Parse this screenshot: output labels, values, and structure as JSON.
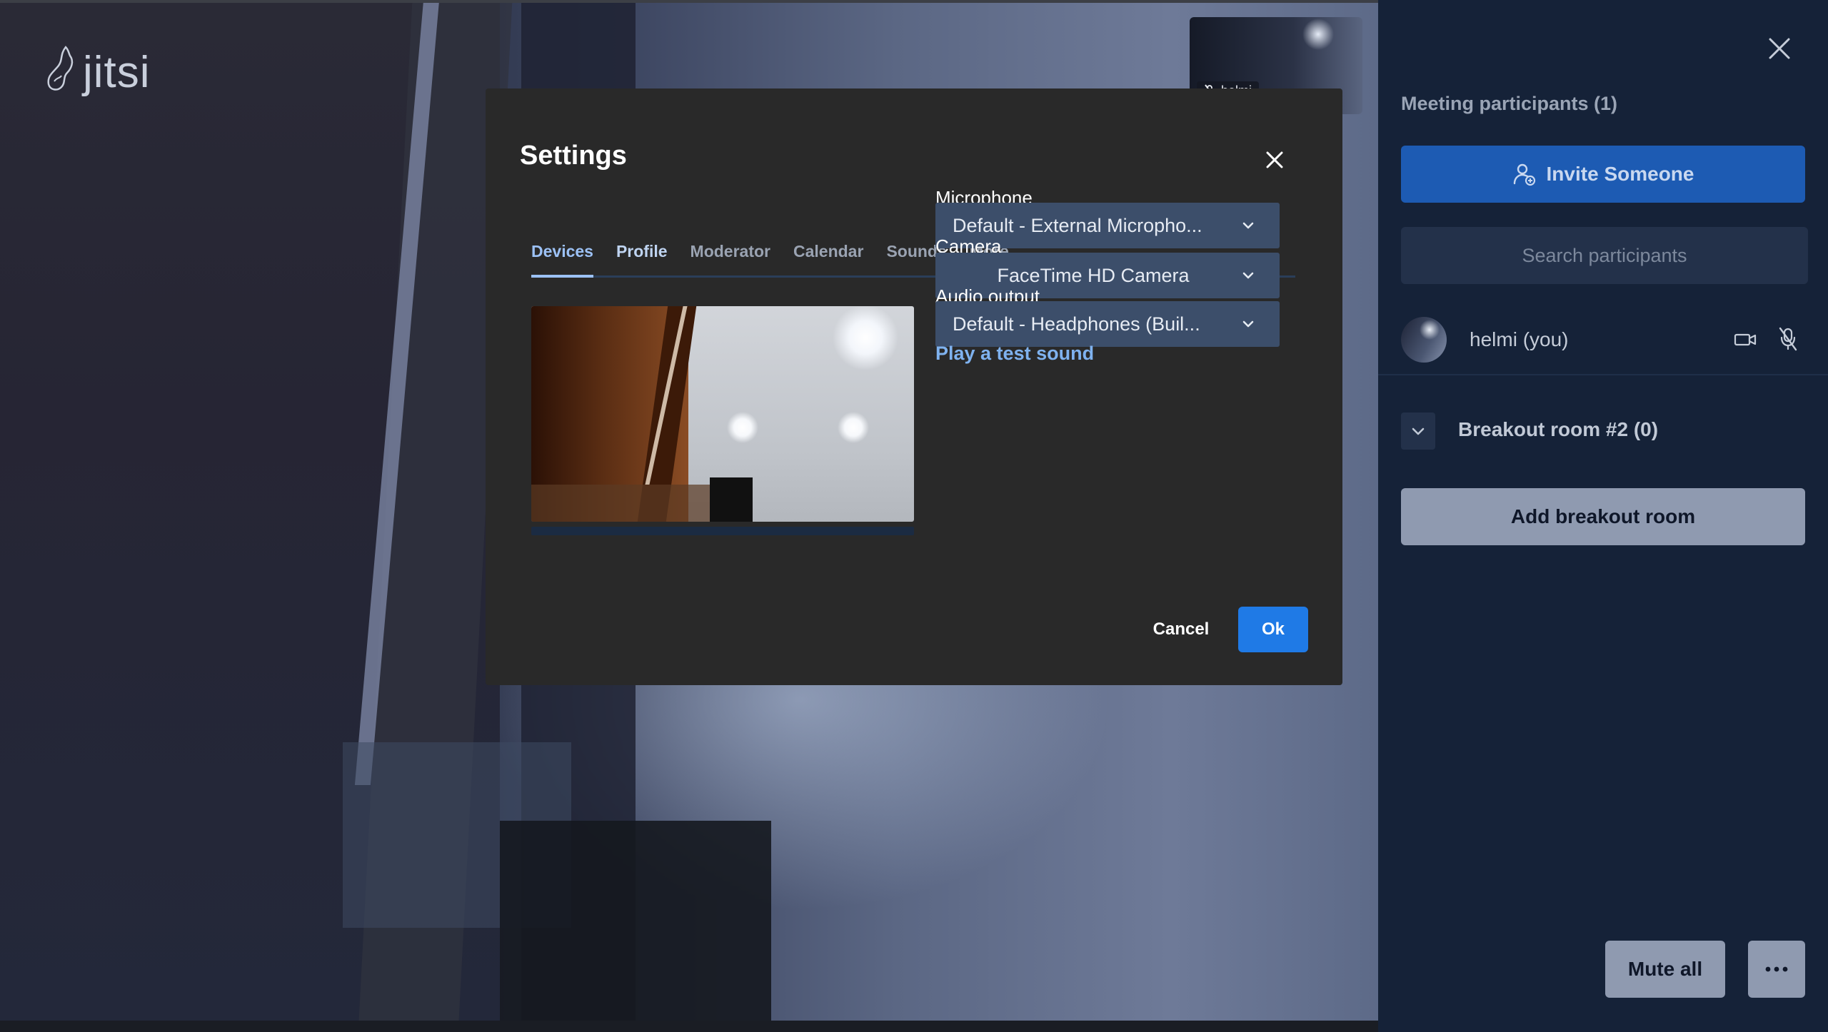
{
  "brand": {
    "logo_text": "jitsi"
  },
  "thumbnail": {
    "name": "helmi"
  },
  "settings": {
    "title": "Settings",
    "tabs": [
      {
        "label": "Devices",
        "active": true
      },
      {
        "label": "Profile",
        "active": false
      },
      {
        "label": "Moderator",
        "active": false
      },
      {
        "label": "Calendar",
        "active": false
      },
      {
        "label": "Sounds",
        "active": false
      },
      {
        "label": "More",
        "active": false
      }
    ],
    "microphone": {
      "label": "Microphone",
      "value": "Default - External Micropho..."
    },
    "camera": {
      "label": "Camera",
      "value": "FaceTime HD Camera"
    },
    "audio_output": {
      "label": "Audio output",
      "value": "Default - Headphones (Buil..."
    },
    "test_sound": "Play a test sound",
    "cancel": "Cancel",
    "ok": "Ok"
  },
  "participants": {
    "title": "Meeting participants (1)",
    "invite": "Invite Someone",
    "search_placeholder": "Search participants",
    "list": [
      {
        "name": "helmi (you)"
      }
    ],
    "breakout_room": "Breakout room #2 (0)",
    "add_breakout": "Add breakout room",
    "mute_all": "Mute all"
  },
  "colors": {
    "dialog_bg": "#292929",
    "accent": "#1f7ae6",
    "tab_active": "#9cc1f5",
    "panel_bg": "#152238",
    "select_bg": "#3c4e6a"
  }
}
